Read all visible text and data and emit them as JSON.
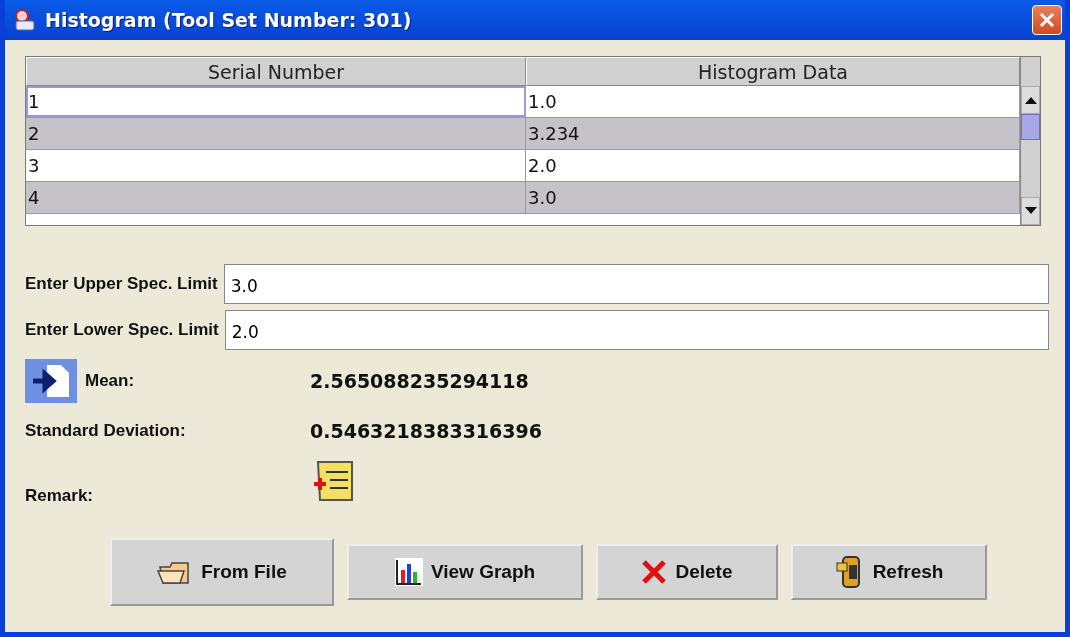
{
  "window": {
    "title": "Histogram (Tool Set Number: 301)"
  },
  "table": {
    "columns": [
      "Serial Number",
      "Histogram Data"
    ],
    "rows": [
      {
        "cells": [
          "1",
          "1.0"
        ],
        "focused": true
      },
      {
        "cells": [
          "2",
          "3.234"
        ],
        "focused": false
      },
      {
        "cells": [
          "3",
          "2.0"
        ],
        "focused": false
      },
      {
        "cells": [
          "4",
          "3.0"
        ],
        "focused": false
      }
    ]
  },
  "fields": [
    {
      "label": "Enter Upper Spec. Limit",
      "value": "3.0"
    },
    {
      "label": "Enter Lower Spec. Limit",
      "value": "2.0"
    }
  ],
  "stats": [
    {
      "label": "Mean:",
      "value": "2.565088235294118"
    },
    {
      "label": "Standard Deviation:",
      "value": "0.5463218383316396"
    }
  ],
  "remark": {
    "label": "Remark:"
  },
  "buttons": [
    {
      "kind": "file",
      "label": "From File"
    },
    {
      "kind": "graph",
      "label": "View Graph"
    },
    {
      "kind": "delete",
      "label": "Delete"
    },
    {
      "kind": "refresh",
      "label": "Refresh"
    }
  ]
}
